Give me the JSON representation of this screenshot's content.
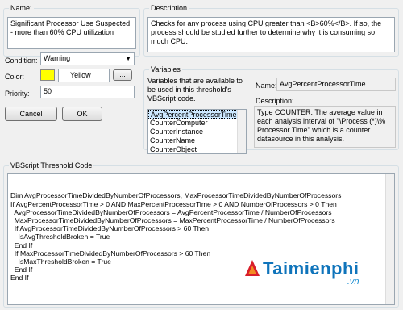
{
  "name": {
    "label": "Name:",
    "value": "Significant Processor Use Suspected - more than 60% CPU utilization"
  },
  "description": {
    "label": "Description",
    "value": "Checks for any process using CPU greater than <B>60%</B>. If so, the process should be studied further to determine why it is consuming so much CPU."
  },
  "condition": {
    "label": "Condition:",
    "value": "Warning"
  },
  "color": {
    "label": "Color:",
    "value": "Yellow",
    "swatch": "#ffff00",
    "browse_label": "..."
  },
  "priority": {
    "label": "Priority:",
    "value": "50"
  },
  "buttons": {
    "cancel": "Cancel",
    "ok": "OK"
  },
  "variables": {
    "label": "Variables",
    "info": "Variables that are available to be used in this threshold's VBScript code.",
    "items": [
      "AvgPercentProcessorTime",
      "CounterComputer",
      "CounterInstance",
      "CounterName",
      "CounterObject"
    ],
    "selected_index": 0,
    "name_label": "Name:",
    "name_value": "AvgPercentProcessorTime",
    "desc_label": "Description:",
    "desc_value": "Type COUNTER. The average value in each analysis interval of \"\\Process (*)\\% Processor Time\" which is a counter datasource in this analysis."
  },
  "vbscript": {
    "label": "VBScript Threshold Code",
    "lines": [
      "Dim AvgProcessorTimeDividedByNumberOfProcessors, MaxProcessorTimeDividedByNumberOfProcessors",
      "If AvgPercentProcessorTime > 0 AND MaxPercentProcessorTime > 0 AND NumberOfProcessors > 0 Then",
      "  AvgProcessorTimeDividedByNumberOfProcessors = AvgPercentProcessorTime / NumberOfProcessors",
      "  MaxProcessorTimeDividedByNumberOfProcessors = MaxPercentProcessorTime / NumberOfProcessors",
      "  If AvgProcessorTimeDividedByNumberOfProcessors > 60 Then",
      "    IsAvgThresholdBroken = True",
      "  End If",
      "  If MaxProcessorTimeDividedByNumberOfProcessors > 60 Then",
      "    IsMaxThresholdBroken = True",
      "  End If",
      "End If"
    ]
  },
  "watermark": {
    "text": "Taimienphi",
    "suffix": ".vn"
  }
}
